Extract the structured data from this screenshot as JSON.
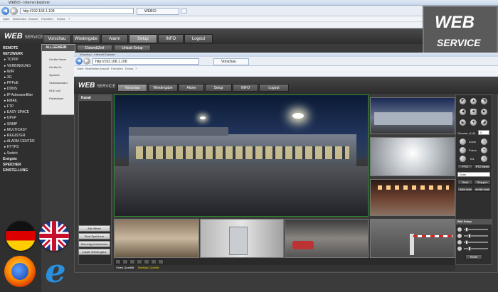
{
  "outer_browser": {
    "title": "WEBIO - Internet Explorer",
    "address": "http://192.168.1.108",
    "tab": "WEBIO",
    "menu": [
      "Datei",
      "Bearbeiten",
      "Ansicht",
      "Favoriten",
      "Extras",
      "?"
    ]
  },
  "badge": {
    "line1": "WEB",
    "line2": "SERVICE"
  },
  "app": {
    "logo_main": "WEB",
    "logo_sub": "SERVICE",
    "nav": [
      "Vorschau",
      "Wiedergabe",
      "Alarm",
      "Setup",
      "INFO",
      "Logout"
    ],
    "active_nav": "Setup",
    "subtabs": [
      "Datum&Zeit",
      "Urlaub Setup"
    ],
    "left_menu": [
      {
        "label": "REMOTE",
        "sub": false
      },
      {
        "label": "NETZWERK",
        "sub": false
      },
      {
        "label": "TCP/IP",
        "sub": true
      },
      {
        "label": "VERBINDUNG",
        "sub": true
      },
      {
        "label": "WIFI",
        "sub": true
      },
      {
        "label": "3G",
        "sub": true
      },
      {
        "label": "PPPoE",
        "sub": true
      },
      {
        "label": "DDNS",
        "sub": true
      },
      {
        "label": "IP Adressenfilter",
        "sub": true
      },
      {
        "label": "EMAIL",
        "sub": true
      },
      {
        "label": "FTP",
        "sub": true
      },
      {
        "label": "EASY SPACE",
        "sub": true
      },
      {
        "label": "UPnP",
        "sub": true
      },
      {
        "label": "SNMP",
        "sub": true
      },
      {
        "label": "MULTICAST",
        "sub": true
      },
      {
        "label": "REGISTER",
        "sub": true
      },
      {
        "label": "ALARM CENTER",
        "sub": true
      },
      {
        "label": "HTTPS",
        "sub": true
      },
      {
        "label": "Switch",
        "sub": true
      },
      {
        "label": "Ereignis",
        "sub": false
      },
      {
        "label": "SPEICHER",
        "sub": false
      },
      {
        "label": "EINSTELLUNG",
        "sub": false
      }
    ],
    "allgemein": {
      "header": "ALLGEMEIN",
      "items": [
        "Geräte Name",
        "Geräte Nr.",
        "Sprache",
        "Videostandard",
        "HDD voll",
        "Paketdauer"
      ]
    }
  },
  "inner_browser": {
    "title": "Vorschau - Internet Explorer",
    "address": "http://192.168.1.108",
    "tab": "Vorschau",
    "menu": [
      "Datei",
      "Bearbeiten",
      "Ansicht",
      "Favoriten",
      "Extras",
      "?"
    ],
    "nav": [
      "Vorschau",
      "Wiedergabe",
      "Alarm",
      "Setup",
      "INFO",
      "Logout"
    ],
    "active_nav": "Vorschau",
    "cam_header": "Kanal",
    "cam_buttons": [
      "Alle öffnen",
      "Start Speichern",
      "Schnellgr.Aufnahmen",
      "Lokale Wiedergabe"
    ],
    "quality_label": "Video Qualität",
    "quality_value": "Niedrige Qualität",
    "ptz": {
      "speed_label": "Geschw. (1-8)",
      "speed_value": "5",
      "zoom": "Zoom",
      "focus": "Fokus",
      "iris": "Iris",
      "tabs": [
        "PTZ",
        "PTZ Menü"
      ],
      "select": "Scan",
      "start": "Start",
      "stop": "Stoppen",
      "links": "Links scan",
      "rechts": "rechts scan",
      "bild_setup": "Bild Setup",
      "reset": "Reset"
    }
  },
  "flags": [
    "germany-flag",
    "uk-flag",
    "firefox-logo",
    "ie-logo"
  ]
}
